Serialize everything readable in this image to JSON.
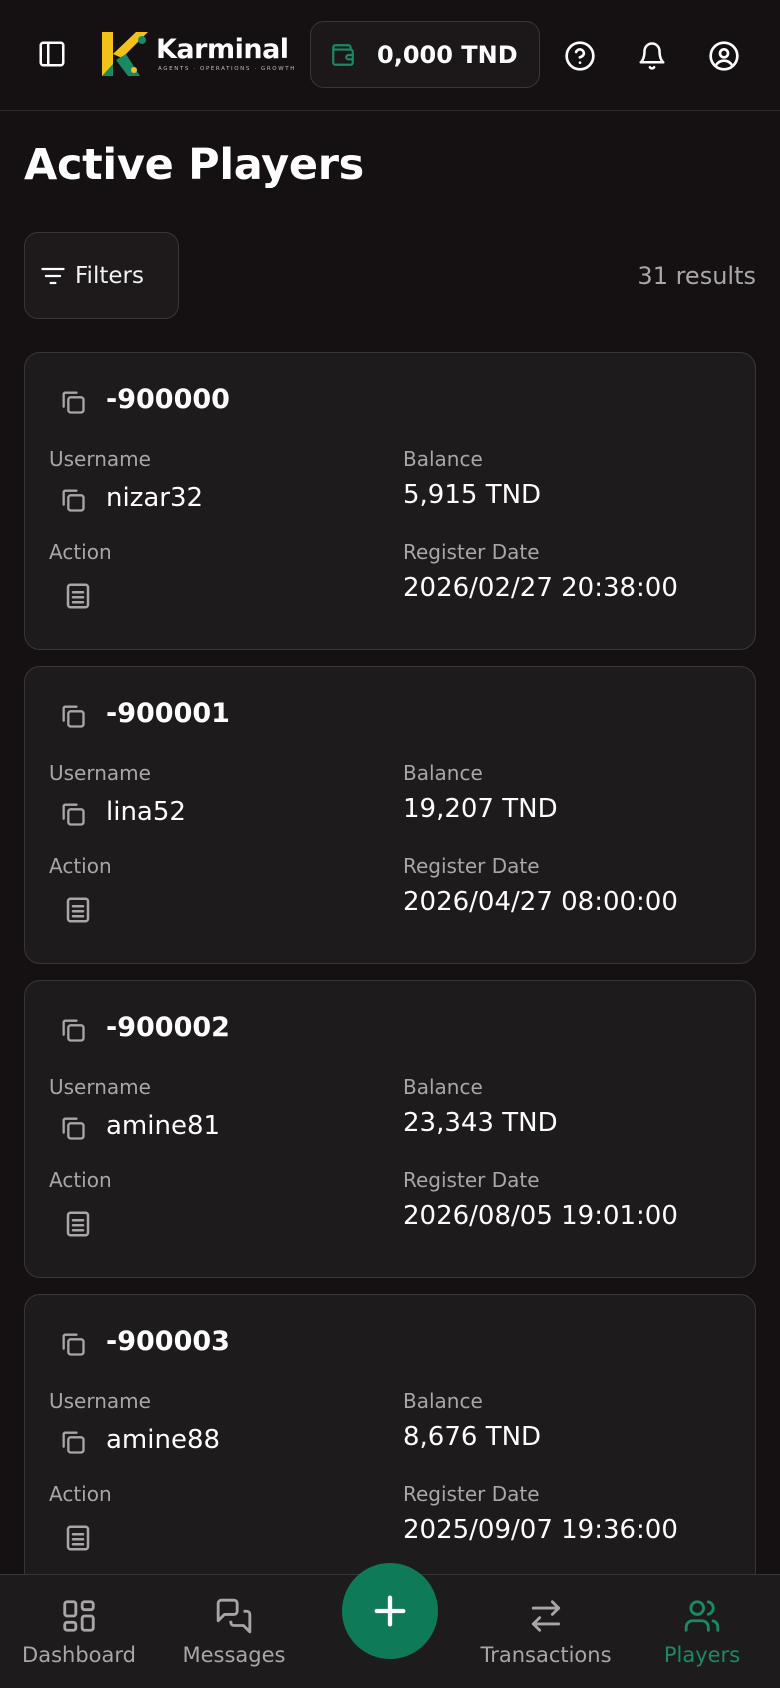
{
  "header": {
    "brand_name": "Karminal",
    "brand_tagline": "AGENTS · OPERATIONS · GROWTH",
    "wallet_amount": "0,000 TND"
  },
  "page": {
    "title": "Active Players",
    "filters_label": "Filters",
    "results_text": "31 results"
  },
  "labels": {
    "username": "Username",
    "balance": "Balance",
    "action": "Action",
    "register_date": "Register Date"
  },
  "players": [
    {
      "id": "-900000",
      "username": "nizar32",
      "balance": "5,915 TND",
      "register_date": "2026/02/27 20:38:00"
    },
    {
      "id": "-900001",
      "username": "lina52",
      "balance": "19,207 TND",
      "register_date": "2026/04/27 08:00:00"
    },
    {
      "id": "-900002",
      "username": "amine81",
      "balance": "23,343 TND",
      "register_date": "2026/08/05 19:01:00"
    },
    {
      "id": "-900003",
      "username": "amine88",
      "balance": "8,676 TND",
      "register_date": "2025/09/07 19:36:00"
    }
  ],
  "nav": {
    "dashboard": "Dashboard",
    "messages": "Messages",
    "transactions": "Transactions",
    "players": "Players"
  },
  "colors": {
    "accent": "#0f7a58",
    "active_nav": "#1a8a66",
    "background": "#151112",
    "card": "#1e1b1c"
  },
  "icons": [
    "sidebar-toggle-icon",
    "wallet-icon",
    "help-icon",
    "bell-icon",
    "user-icon",
    "filter-icon",
    "copy-icon",
    "document-icon",
    "dashboard-icon",
    "messages-icon",
    "plus-icon",
    "transactions-icon",
    "players-icon"
  ]
}
